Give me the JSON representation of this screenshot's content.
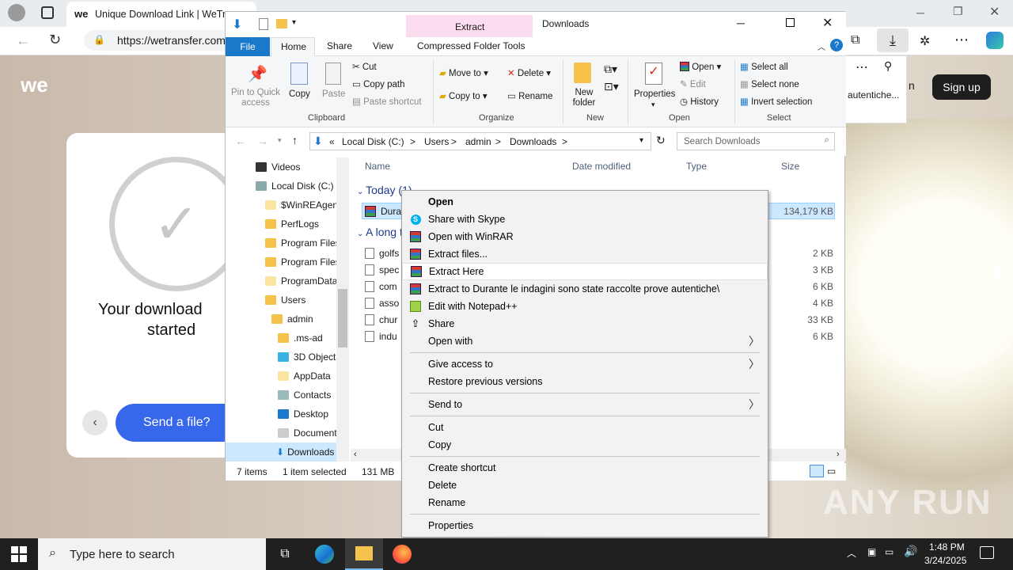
{
  "browser": {
    "tab_title": "Unique Download Link | WeTra",
    "url": "https://wetransfer.com"
  },
  "wetransfer": {
    "logo": "we",
    "download_msg_line1": "Your download",
    "download_msg_line2": "started",
    "send_button": "Send a file?",
    "signup": "Sign up",
    "popup_text": "autentiche...",
    "popup_letter": "n"
  },
  "explorer": {
    "context_tab": "Extract",
    "window_title": "Downloads",
    "tabs": {
      "file": "File",
      "home": "Home",
      "share": "Share",
      "view": "View",
      "compressed": "Compressed Folder Tools"
    },
    "ribbon": {
      "pin": "Pin to Quick access",
      "copy": "Copy",
      "paste": "Paste",
      "cut": "Cut",
      "copy_path": "Copy path",
      "paste_shortcut": "Paste shortcut",
      "clipboard": "Clipboard",
      "move_to": "Move to",
      "copy_to": "Copy to",
      "delete": "Delete",
      "rename": "Rename",
      "organize": "Organize",
      "new_folder": "New folder",
      "new": "New",
      "properties": "Properties",
      "open": "Open",
      "edit": "Edit",
      "history": "History",
      "open_group": "Open",
      "select_all": "Select all",
      "select_none": "Select none",
      "invert_selection": "Invert selection",
      "select": "Select"
    },
    "address": {
      "sep": "«",
      "p1": "Local Disk (C:)",
      "p2": "Users",
      "p3": "admin",
      "p4": "Downloads",
      "chev": ">"
    },
    "search_placeholder": "Search Downloads",
    "nav": [
      "Videos",
      "Local Disk (C:)",
      "$WinREAgent",
      "PerfLogs",
      "Program Files",
      "Program Files",
      "ProgramData",
      "Users",
      "admin",
      ".ms-ad",
      "3D Objects",
      "AppData",
      "Contacts",
      "Desktop",
      "Documents",
      "Downloads"
    ],
    "columns": {
      "name": "Name",
      "date": "Date modified",
      "type": "Type",
      "size": "Size"
    },
    "group_today": "Today (1)",
    "group_long": "A long time ago",
    "files": [
      {
        "name": "Dura",
        "size": "134,179 KB"
      },
      {
        "name": "golfs",
        "size": "2 KB"
      },
      {
        "name": "spec",
        "size": "3 KB"
      },
      {
        "name": "com",
        "size": "6 KB"
      },
      {
        "name": "asso",
        "size": "4 KB"
      },
      {
        "name": "chur",
        "size": "33 KB"
      },
      {
        "name": "indu",
        "size": "6 KB"
      }
    ],
    "status": {
      "items": "7 items",
      "selected": "1 item selected",
      "size": "131 MB"
    }
  },
  "context_menu": {
    "open": "Open",
    "share_skype": "Share with Skype",
    "open_winrar": "Open with WinRAR",
    "extract_files": "Extract files...",
    "extract_here": "Extract Here",
    "extract_to": "Extract to Durante le indagini sono state raccolte prove autentiche\\",
    "edit_notepad": "Edit with Notepad++",
    "share": "Share",
    "open_with": "Open with",
    "give_access": "Give access to",
    "restore": "Restore previous versions",
    "send_to": "Send to",
    "cut": "Cut",
    "copy": "Copy",
    "create_shortcut": "Create shortcut",
    "delete": "Delete",
    "rename": "Rename",
    "properties": "Properties"
  },
  "taskbar": {
    "search_placeholder": "Type here to search",
    "time": "1:48 PM",
    "date": "3/24/2025"
  },
  "watermark": "ANY RUN"
}
